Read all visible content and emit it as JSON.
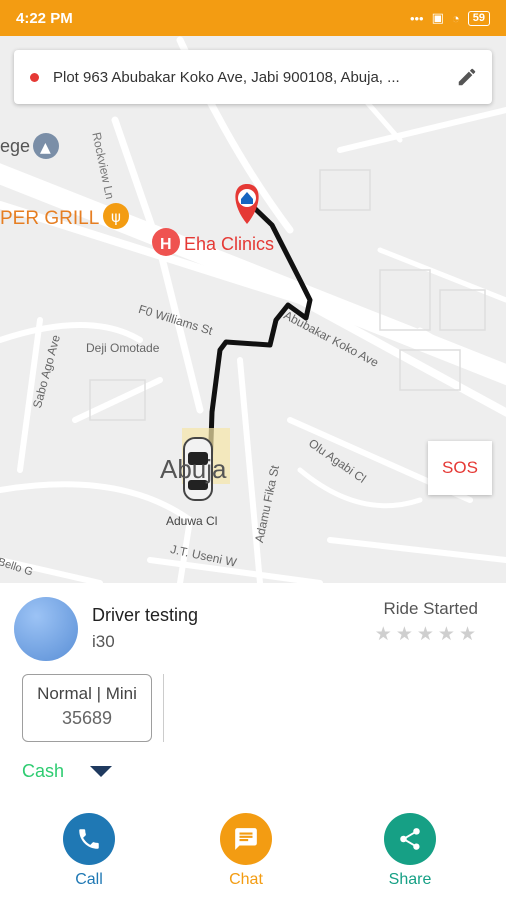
{
  "status_bar": {
    "time": "4:22 PM",
    "battery": "59"
  },
  "address_bar": {
    "address": "Plot 963 Abubakar Koko Ave, Jabi 900108, Abuja, ..."
  },
  "map": {
    "place_labels": {
      "college": "ege",
      "grill": "PER GRILL",
      "clinic": "Eha Clinics",
      "city": "Abuja"
    },
    "street_labels": {
      "rockview": "Rockview Ln",
      "williams": "F0 Williams St",
      "koko": "Abubakar Koko Ave",
      "omotade": "Deji Omotade",
      "sabo": "Sabo Ago Ave",
      "olu": "Olu Agabi Cl",
      "adamu": "Adamu Fika St",
      "aduwa": "Aduwa Cl",
      "useni": "J.T. Useni W",
      "bello": "Bello G"
    }
  },
  "sos_label": "SOS",
  "driver": {
    "name": "Driver testing",
    "car_model": "i30",
    "ride_status": "Ride Started",
    "rating_stars": 0,
    "max_stars": 5
  },
  "fare": {
    "type": "Normal | Mini",
    "amount": "35689"
  },
  "payment": {
    "method": "Cash"
  },
  "actions": [
    {
      "label": "Call",
      "color": "#1f78b4"
    },
    {
      "label": "Chat",
      "color": "#f39c12"
    },
    {
      "label": "Share",
      "color": "#16a085"
    }
  ],
  "colors": {
    "accent": "#f39c12",
    "sos": "#e53935",
    "cash": "#2ecc71"
  }
}
